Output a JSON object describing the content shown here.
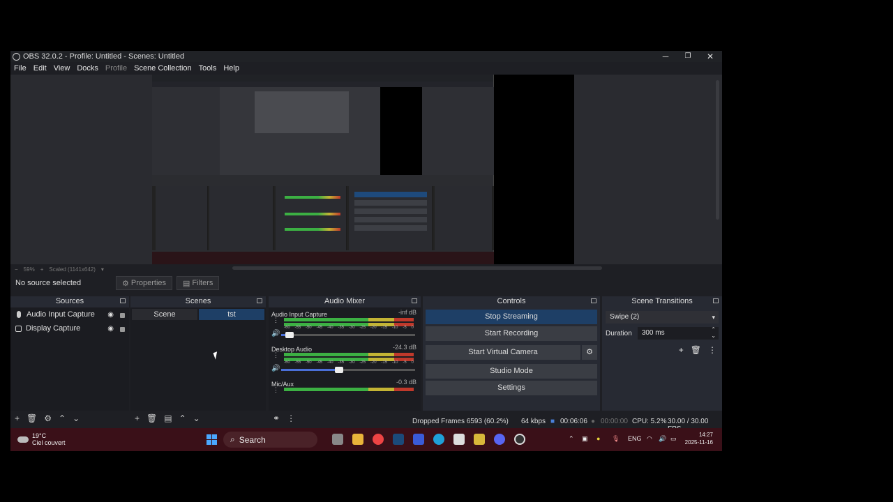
{
  "window": {
    "title": "OBS 32.0.2 - Profile: Untitled - Scenes: Untitled",
    "minimize": "─",
    "restore": "❐",
    "close": "✕"
  },
  "menu": [
    "File",
    "Edit",
    "View",
    "Docks",
    "Profile",
    "Scene Collection",
    "Tools",
    "Help"
  ],
  "zoom": {
    "minus": "−",
    "percent": "59%",
    "plus": "+",
    "scaled": "Scaled (1141x642)",
    "caret": "▾"
  },
  "context": {
    "no_source": "No source selected",
    "properties": "Properties",
    "filters": "Filters"
  },
  "docks": {
    "sources": {
      "title": "Sources",
      "items": [
        {
          "label": "Audio Input Capture",
          "icon": "mic-icon"
        },
        {
          "label": "Display Capture",
          "icon": "monitor-icon"
        }
      ]
    },
    "scenes": {
      "title": "Scenes",
      "items": [
        {
          "label": "Scene",
          "active": false
        },
        {
          "label": "tst",
          "active": true
        }
      ]
    },
    "mixer": {
      "title": "Audio Mixer",
      "scale": [
        "-60",
        "-55",
        "-50",
        "-45",
        "-40",
        "-35",
        "-30",
        "-25",
        "-20",
        "-15",
        "-10",
        "-5",
        "0"
      ],
      "channels": [
        {
          "name": "Audio Input Capture",
          "db": "-inf dB",
          "level": 0.06
        },
        {
          "name": "Desktop Audio",
          "db": "-24.3 dB",
          "level": 0.43
        },
        {
          "name": "Mic/Aux",
          "db": "-0.3 dB",
          "level": 1.0
        }
      ]
    },
    "controls": {
      "title": "Controls",
      "stop_streaming": "Stop Streaming",
      "start_recording": "Start Recording",
      "start_virtual_camera": "Start Virtual Camera",
      "studio_mode": "Studio Mode",
      "settings": "Settings"
    },
    "transitions": {
      "title": "Scene Transitions",
      "selected": "Swipe (2)",
      "duration_label": "Duration",
      "duration_value": "300 ms"
    }
  },
  "status": {
    "dropped": "Dropped Frames 6593 (60.2%)",
    "kbps": "64 kbps",
    "stream_time": "00:06:06",
    "rec_time": "00:00:00",
    "cpu": "CPU: 5.2%",
    "fps": "30.00 / 30.00 FPS"
  },
  "taskbar": {
    "temp": "19°C",
    "weather": "Ciel couvert",
    "search": "Search",
    "lang": "ENG",
    "time": "14:27",
    "date": "2025-11-16"
  },
  "colors": {
    "accent": "#1e3f66",
    "taskbar": "#3a1018",
    "dock": "#272a33"
  }
}
